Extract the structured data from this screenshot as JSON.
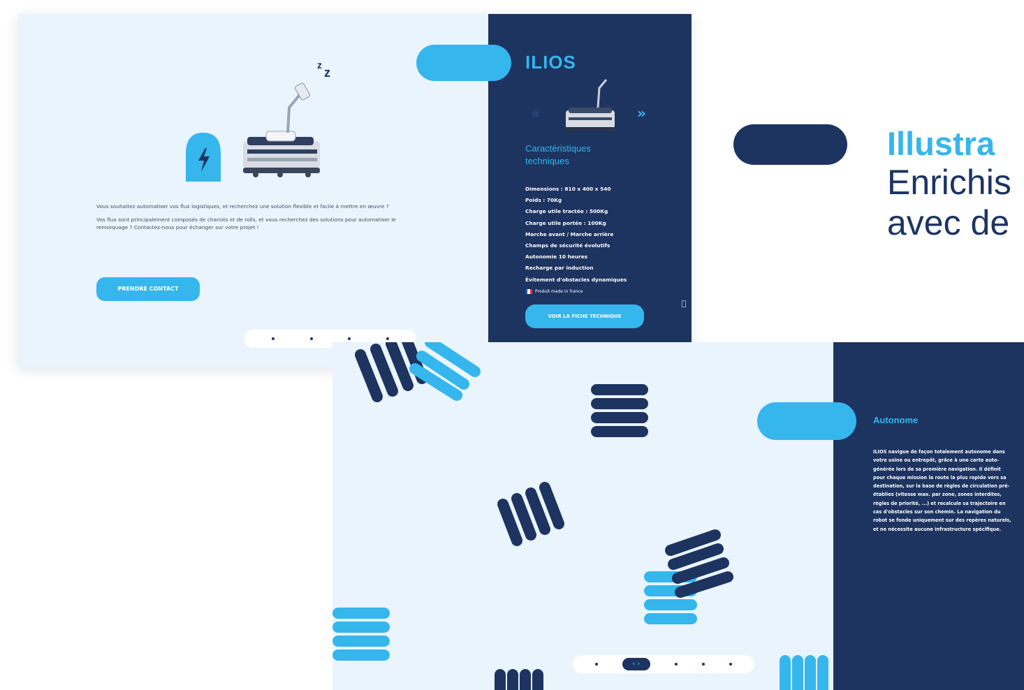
{
  "colors": {
    "navy": "#1d3461",
    "sky": "#35b6ec",
    "panel_bg": "#eaf4fc",
    "white": "#ffffff"
  },
  "headline": {
    "title": "Illustra",
    "subtitle_line1": "Enrichis",
    "subtitle_line2": "avec de"
  },
  "screen1": {
    "illustration": {
      "icons": [
        "lightning-icon",
        "sleep-zzz-icon",
        "robot-icon"
      ],
      "sleep_text": "zZz"
    },
    "intro_paragraph_1": "Vous souhaitez automatiser vos flux logistiques, et recherchez une solution flexible et facile à mettre en œuvre ?",
    "intro_paragraph_2": "Vos flux sont principalement composés de chariots et de rolls, et vous recherchez des solutions pour automatiser le remorquage ? Contactez-nous pour échanger sur votre projet !",
    "cta_label": "PRENDRE CONTACT",
    "pagination_dots": 4,
    "product": {
      "name": "ILIOS",
      "prev_icon": "«",
      "next_icon": "»",
      "section_title": "Caractéristiques techniques",
      "specs": [
        "Dimensions : 810 x 400 x 540",
        "Poids : 70Kg",
        "Charge utile tractée : 500Kg",
        "Charge utile portée : 100Kg",
        "Marche avant / Marche arrière",
        "Champs de sécurité évolutifs",
        "Autonomie 10 heures",
        "Recharge par induction",
        "Évitement d'obstacles dynamiques"
      ],
      "made_in": "Produit made in france",
      "sheet_button": "VOIR LA FICHE TECHNIQUE"
    }
  },
  "screen2": {
    "side_title": "Autonome",
    "side_text": "ILIOS navigue de façon totalement autonome dans votre usine ou entrepôt, grâce à une carte auto-générée lors de sa première navigation. Il définit pour chaque mission la route la plus rapide vers sa destination, sur la base de règles de circulation pré-établies (vitesse max. par zone, zones interdites, règles de priorité, ...) et recalcule sa trajectoire en cas d'obstacles sur son chemin. La navigation du robot se fonde uniquement sur des repères naturels, et ne nécessite aucune infrastructure spécifique.",
    "pagination": {
      "active_label": "‹ ›",
      "dots": 5
    }
  }
}
